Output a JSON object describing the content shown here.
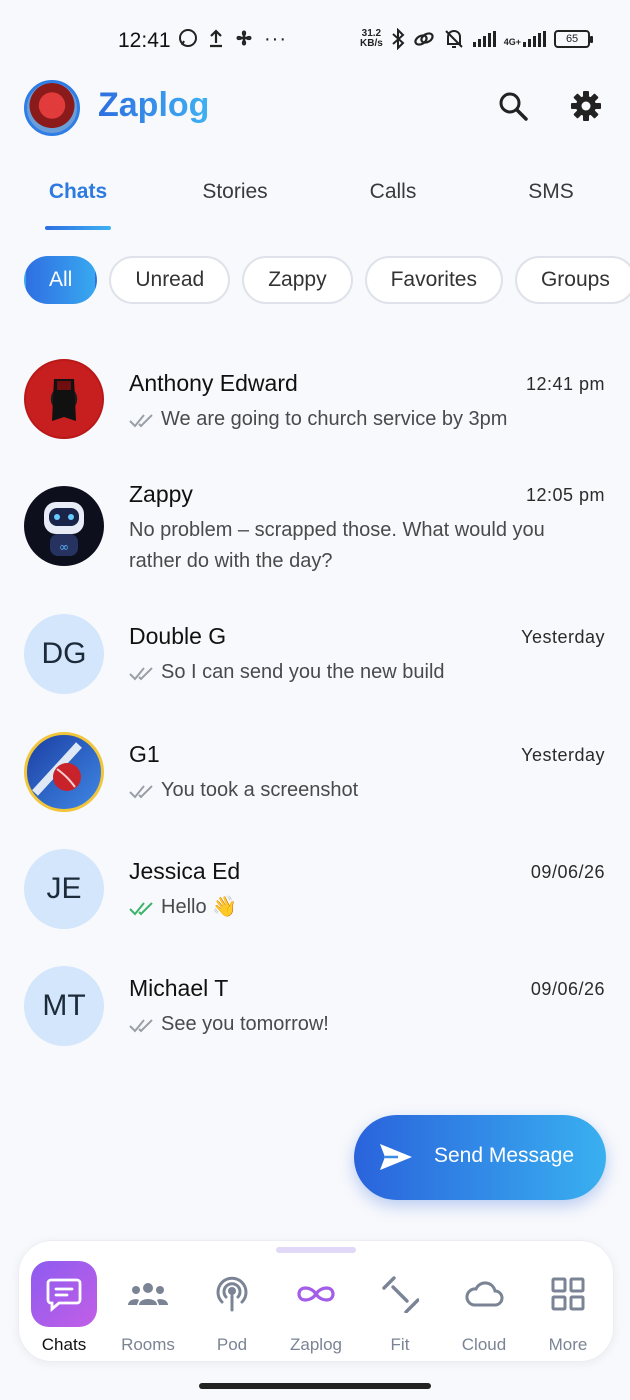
{
  "status_bar": {
    "time": "12:41",
    "net_speed_top": "31.2",
    "net_speed_bottom": "KB/s",
    "net_type": "4G+",
    "battery": "65"
  },
  "header": {
    "title": "Zaplog"
  },
  "tabs": [
    {
      "label": "Chats",
      "active": true
    },
    {
      "label": "Stories",
      "active": false
    },
    {
      "label": "Calls",
      "active": false
    },
    {
      "label": "SMS",
      "active": false
    }
  ],
  "filters": [
    {
      "label": "All",
      "active": true
    },
    {
      "label": "Unread",
      "active": false
    },
    {
      "label": "Zappy",
      "active": false
    },
    {
      "label": "Favorites",
      "active": false
    },
    {
      "label": "Groups",
      "active": false
    }
  ],
  "chats": [
    {
      "name": "Anthony Edward",
      "time": "12:41 pm",
      "preview": "We are going to church service by 3pm",
      "ticks": "read-gray",
      "avatar": "superhero-image"
    },
    {
      "name": "Zappy",
      "time": "12:05 pm",
      "preview": "No problem – scrapped those. What would you rather do with the day?",
      "ticks": "none",
      "avatar": "robot-image"
    },
    {
      "name": "Double G",
      "time": "Yesterday",
      "preview": "So I can send you the new build",
      "ticks": "read-gray",
      "initials": "DG"
    },
    {
      "name": "G1",
      "time": "Yesterday",
      "preview": "You took a screenshot",
      "ticks": "read-gray",
      "avatar": "cricket-image"
    },
    {
      "name": "Jessica Ed",
      "time": "09/06/26",
      "preview": "Hello 👋",
      "ticks": "read-green",
      "initials": "JE"
    },
    {
      "name": "Michael T",
      "time": "09/06/26",
      "preview": "See you tomorrow!",
      "ticks": "read-gray",
      "initials": "MT"
    }
  ],
  "fab": {
    "label": "Send Message",
    "icon": "send-icon"
  },
  "nav": [
    {
      "label": "Chats",
      "icon": "chat-bubble-icon",
      "active": true
    },
    {
      "label": "Rooms",
      "icon": "people-icon",
      "active": false
    },
    {
      "label": "Pod",
      "icon": "podcast-icon",
      "active": false
    },
    {
      "label": "Zaplog",
      "icon": "infinity-icon",
      "active": false
    },
    {
      "label": "Fit",
      "icon": "dumbbell-icon",
      "active": false
    },
    {
      "label": "Cloud",
      "icon": "cloud-icon",
      "active": false
    },
    {
      "label": "More",
      "icon": "grid-icon",
      "active": false
    }
  ],
  "colors": {
    "accent": "#2d7ae0",
    "nav_active": "#a35de9",
    "read_tick_green": "#3bb36b",
    "read_tick_gray": "#9aa0a8"
  }
}
